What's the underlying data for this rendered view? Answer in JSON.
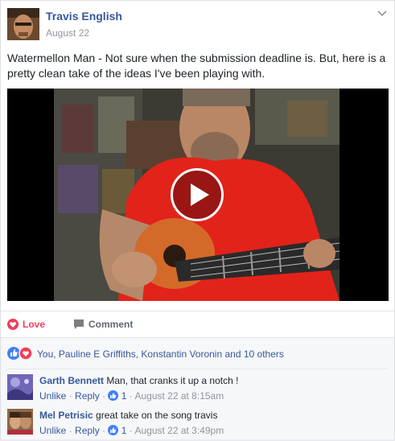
{
  "post": {
    "author": "Travis English",
    "date": "August 22",
    "text": "Watermellon Man - Not sure when the submission deadline is. But, here is a pretty clean take of the ideas I've been playing with."
  },
  "actions": {
    "love_label": "Love",
    "comment_label": "Comment"
  },
  "reactions": {
    "summary": "You, Pauline E Griffiths, Konstantin Voronin and 10 others"
  },
  "comments": [
    {
      "name": "Garth Bennett",
      "text": "Man, that cranks it up a notch !",
      "unlike": "Unlike",
      "reply": "Reply",
      "likes": "1",
      "time": "August 22 at 8:15am",
      "sep1": "·",
      "sep2": "·",
      "sep3": "·"
    },
    {
      "name": "Mel Petrisic",
      "text": "great take on the song travis",
      "unlike": "Unlike",
      "reply": "Reply",
      "likes": "1",
      "time": "August 22 at 3:49pm",
      "sep1": "·",
      "sep2": "·",
      "sep3": "·"
    }
  ],
  "colors": {
    "link": "#365899",
    "love": "#f33e58",
    "like": "#4080ff",
    "shirt": "#e2231a"
  },
  "icons": {
    "love": "heart-icon",
    "comment": "comment-bubble-icon",
    "menu": "chevron-down-icon",
    "play": "play-icon"
  }
}
